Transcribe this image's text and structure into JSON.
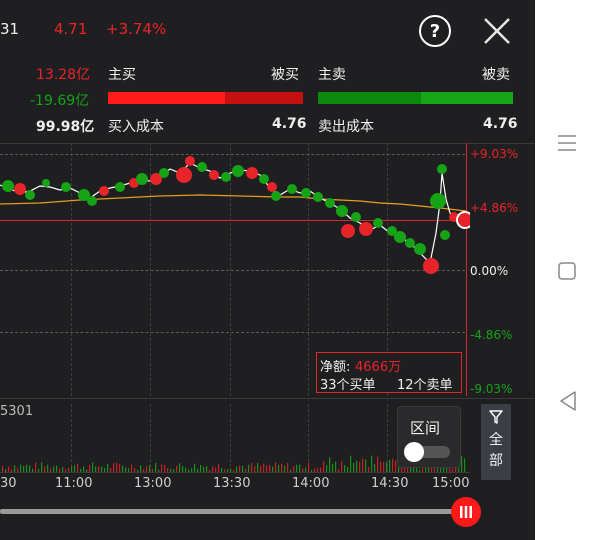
{
  "header": {
    "code_fragment": "31",
    "price": "4.71",
    "change_pct": "+3.74%",
    "help_icon": "help-icon",
    "close_icon": "close-icon"
  },
  "flow": {
    "main_buy_amount": "13.28亿",
    "net_amount": "-19.69亿",
    "total_amount": "99.98亿",
    "main_buy_label": "主买",
    "passive_buy_label": "被买",
    "main_sell_label": "主卖",
    "passive_sell_label": "被卖",
    "buy_cost_label": "买入成本",
    "buy_cost_value": "4.76",
    "sell_cost_label": "卖出成本",
    "sell_cost_value": "4.76",
    "buy_bar_main_ratio": 0.6,
    "sell_bar_main_ratio": 0.53
  },
  "chart": {
    "y_labels": [
      "+9.03%",
      "+4.86%",
      "0.00%",
      "-4.86%",
      "-9.03%"
    ],
    "time_labels": [
      "30",
      "11:00",
      "13:00",
      "13:30",
      "14:00",
      "14:30",
      "15:00"
    ],
    "volume_label": "5301",
    "net_label": "净额:",
    "net_value": "4666万",
    "buy_orders": "33个买单",
    "sell_orders": "12个卖单",
    "range_label": "区间",
    "filter_label_1": "全",
    "filter_label_2": "部",
    "colors": {
      "up": "#e8242b",
      "down": "#16a316",
      "avg_line": "#e0a020"
    }
  },
  "nav": {
    "menu_icon": "menu-icon",
    "home_icon": "home-icon",
    "back_icon": "back-icon"
  }
}
